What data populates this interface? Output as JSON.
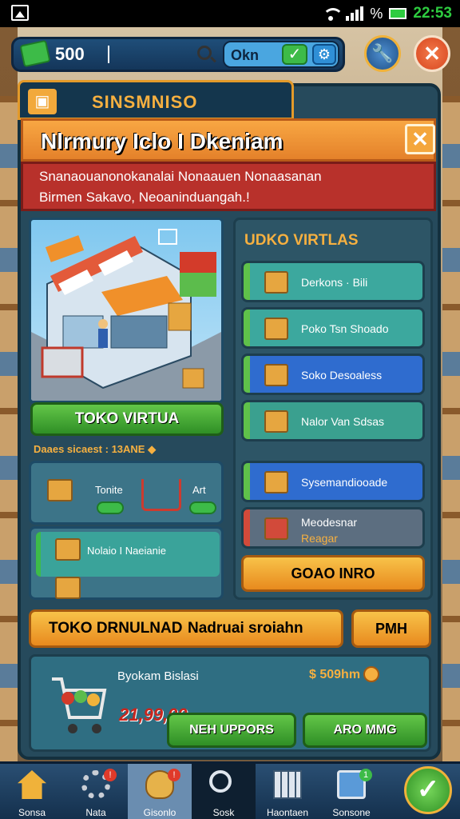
{
  "status_bar": {
    "battery_text": "%",
    "time": "22:53"
  },
  "hud": {
    "money": "500",
    "ok_label": "Okn",
    "icons": [
      "money-icon",
      "search-icon",
      "check-icon",
      "gear-icon",
      "wrench-icon",
      "close-icon"
    ]
  },
  "tab": {
    "title": "SINSMNISO"
  },
  "banner": {
    "title": "Nlrmury Iclo I Dkeniam",
    "alert_line1": "Snanaouanonokanalai Nonaauen Nonaasanan",
    "alert_line2": "Birmen Sakavo, Neoaninduangah.!"
  },
  "store": {
    "main_button": "TOKO VIRTUA",
    "promo_label": "Daaes sicaest : 13ANE ◆",
    "mini_items": [
      {
        "label": "Tonite"
      },
      {
        "label": "Art"
      },
      {
        "label": "Nolaio I Naeianie"
      }
    ]
  },
  "list": {
    "title": "UDKO VIRTLAS",
    "items": [
      {
        "label": "Derkons · Bili",
        "style": "green"
      },
      {
        "label": "Poko Tsn Shoado",
        "style": "green"
      },
      {
        "label": "Soko Desoaless",
        "style": "blue"
      },
      {
        "label": "Nalor Van Sdsas",
        "style": "teal"
      },
      {
        "label": "Sysemandiooade",
        "style": "blue"
      },
      {
        "label": "Meodesnar",
        "label2": "Reagar",
        "style": "grey"
      }
    ],
    "action_button": "GOAO INRO"
  },
  "bar": {
    "left_text": "TOKO DRNULNAD",
    "right_text": "Nadruai sroiahn",
    "side_button": "PMH"
  },
  "card": {
    "title": "Byokam Bislasi",
    "price": "$ 509hm",
    "red_value": "21,99,00",
    "upgrade_button": "NEH UPPORS",
    "other_button": "ARO MMG"
  },
  "nav": {
    "items": [
      {
        "label": "Sonsa",
        "icon": "home-icon"
      },
      {
        "label": "Nata",
        "icon": "gear-icon",
        "badge": "!"
      },
      {
        "label": "Gisonlo",
        "icon": "coin-bag-icon",
        "badge": "!"
      },
      {
        "label": "Sosk",
        "icon": "search-icon"
      },
      {
        "label": "Haontaen",
        "icon": "calendar-icon"
      },
      {
        "label": "Sonsone",
        "icon": "display-icon",
        "badge": "1"
      }
    ]
  },
  "colors": {
    "accent": "#f6b040",
    "panel": "#264a5c",
    "green": "#3dbb48",
    "red": "#b8312b"
  }
}
